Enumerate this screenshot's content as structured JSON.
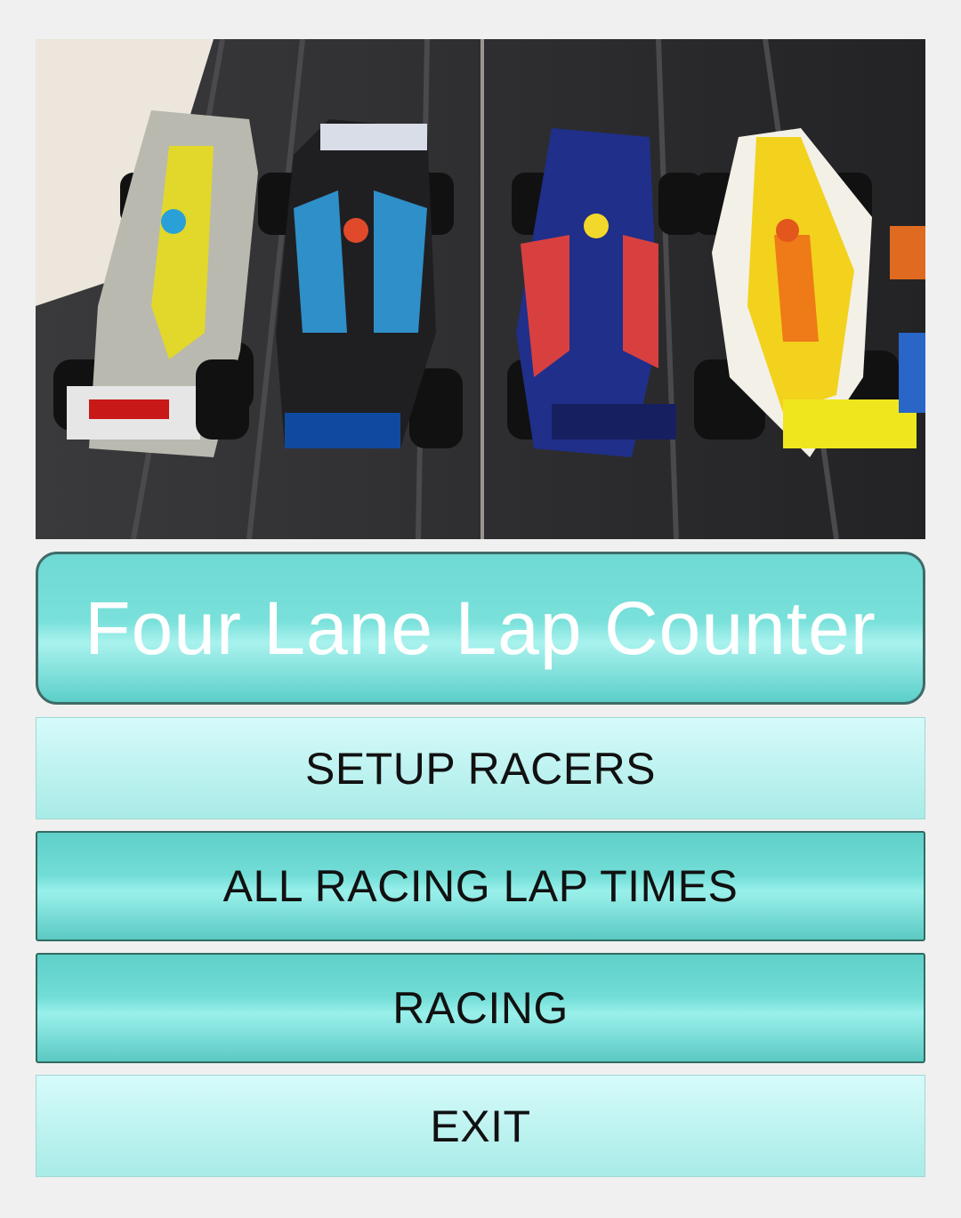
{
  "app": {
    "title": "Four Lane Lap Counter"
  },
  "hero_image": {
    "description_icon": "slot-car-race-track-photo"
  },
  "menu": [
    {
      "label": "SETUP RACERS",
      "style": "light"
    },
    {
      "label": "ALL RACING LAP TIMES",
      "style": "dark"
    },
    {
      "label": "RACING",
      "style": "dark"
    },
    {
      "label": "EXIT",
      "style": "light"
    }
  ],
  "colors": {
    "title_button": "#79e0da",
    "title_border": "#3f6b68",
    "light_button": "#c4f5f3",
    "dark_button": "#6fd9d2",
    "background": "#f0f0f0"
  }
}
